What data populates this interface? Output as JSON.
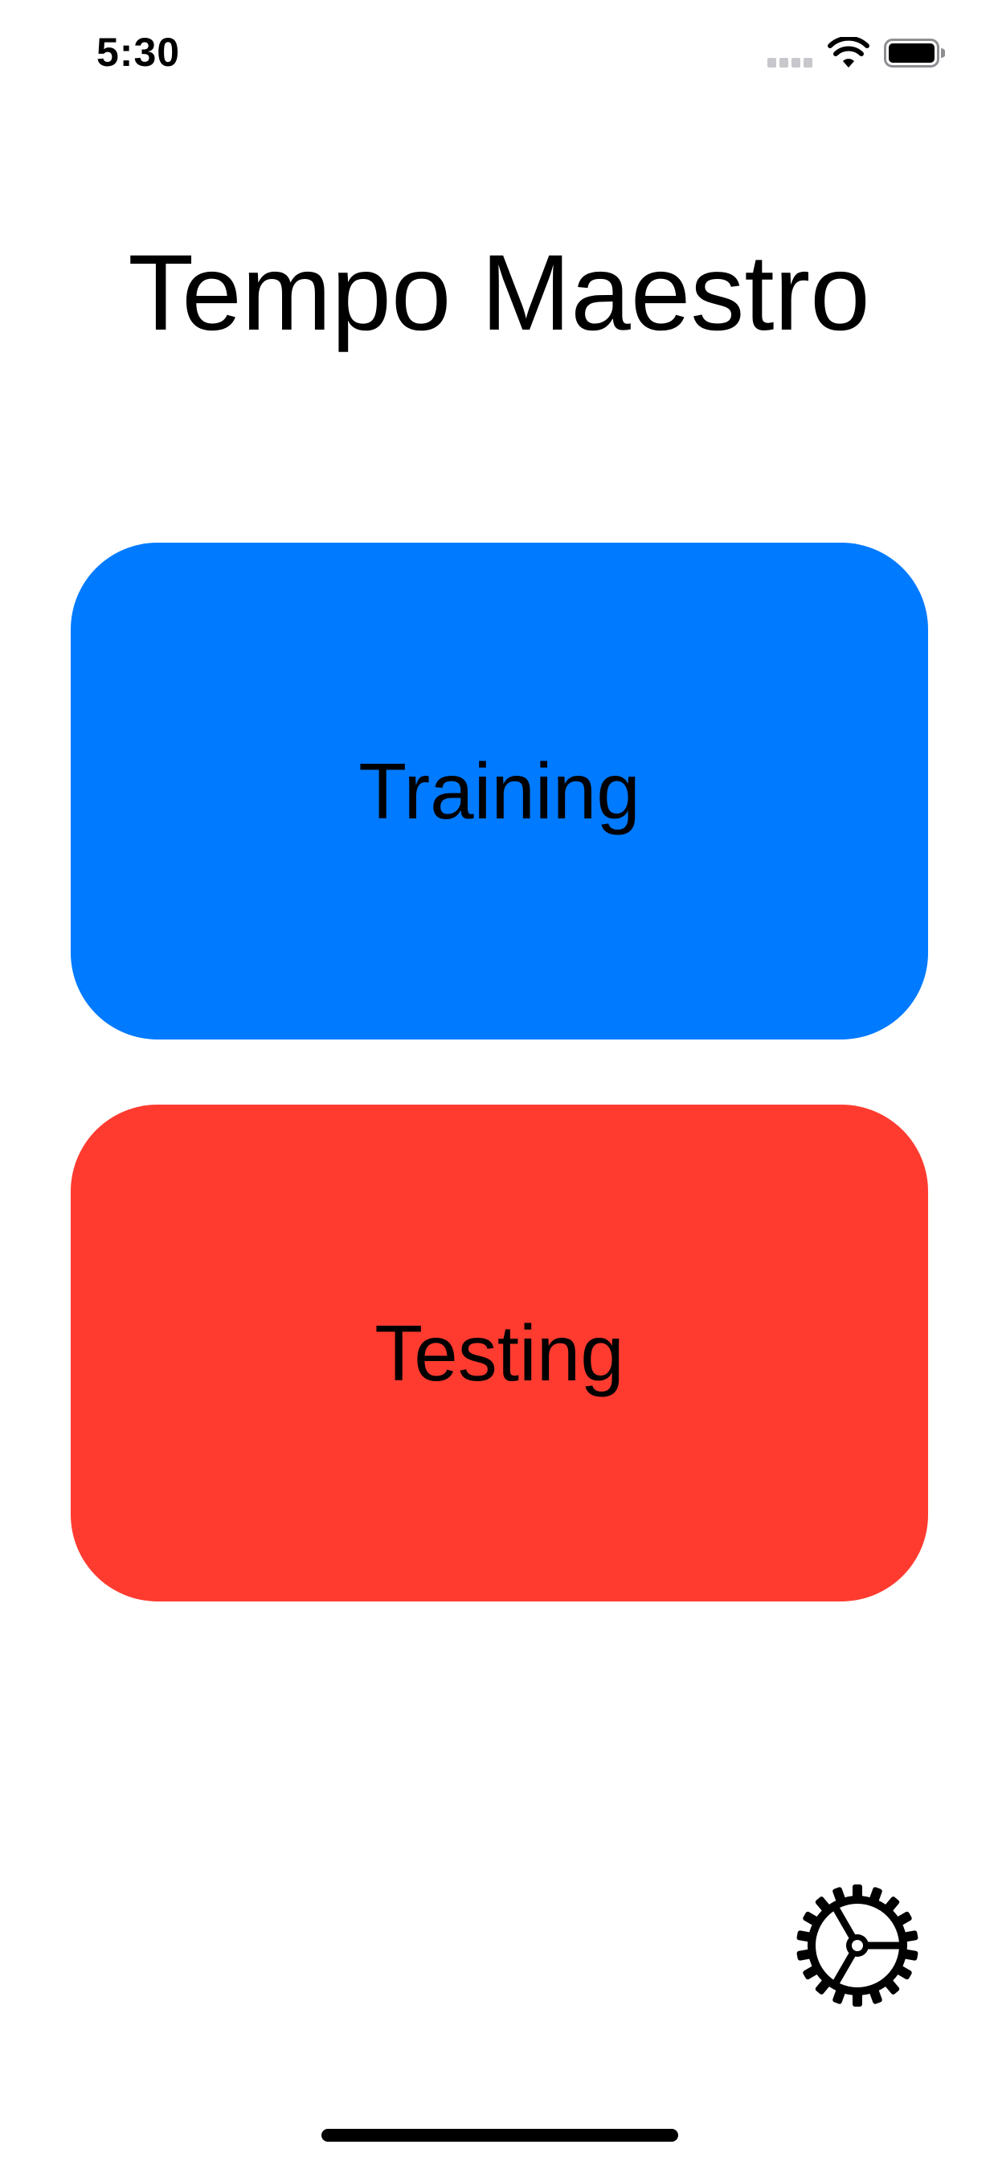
{
  "status_bar": {
    "time": "5:30",
    "icons": [
      "cellular-signal-icon",
      "wifi-icon",
      "battery-icon"
    ]
  },
  "title": "Tempo Maestro",
  "buttons": {
    "training": {
      "label": "Training",
      "color": "#007AFF"
    },
    "testing": {
      "label": "Testing",
      "color": "#FF3B30"
    }
  },
  "settings": {
    "icon": "gear-icon"
  }
}
